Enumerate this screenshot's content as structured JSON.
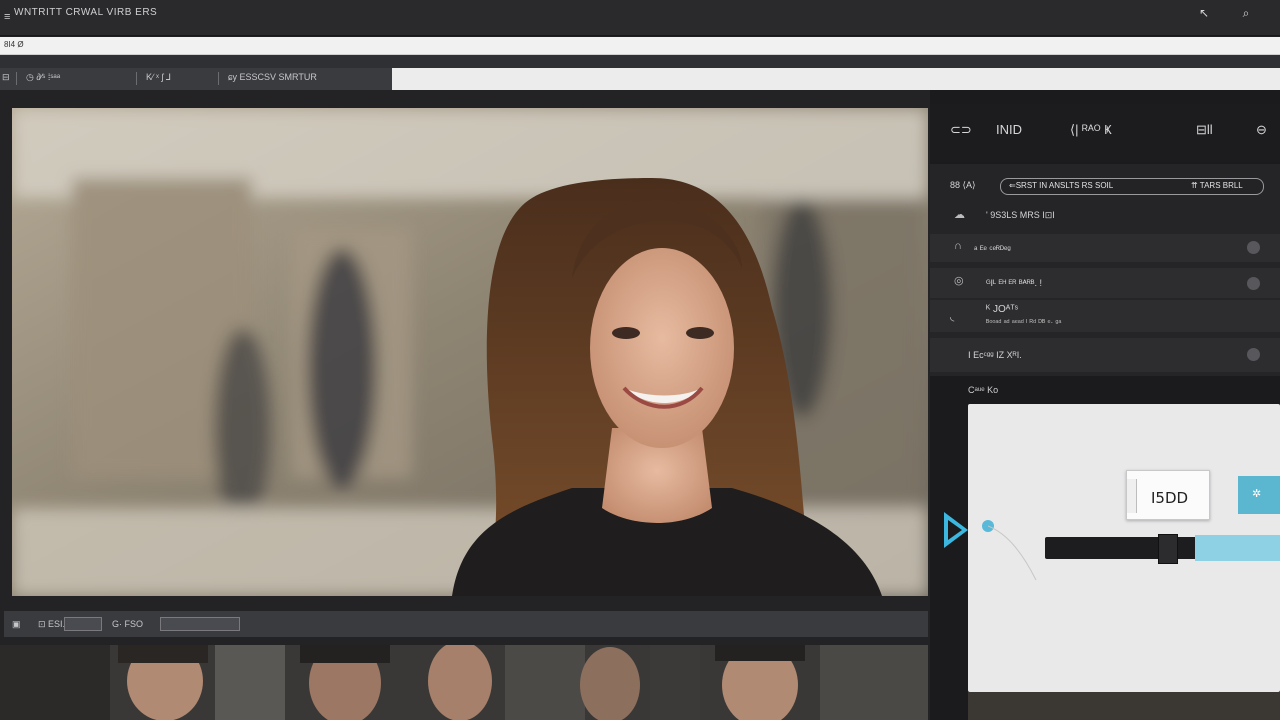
{
  "window": {
    "title": "WNTRITT CRWAL  VIRB ERS",
    "menu_icon": "hamburger-icon",
    "buttons": [
      {
        "icon": "pin-icon",
        "glyph": "↖"
      },
      {
        "icon": "search-icon",
        "glyph": "⌕"
      }
    ]
  },
  "address_bar": {
    "value": "8I4 Ø"
  },
  "toolbar": {
    "items": [
      {
        "icon": "grid-icon",
        "label": "⊟"
      },
      {
        "icon": "clock-icon",
        "label": "◷  ∂⁄ˢ ⁞ˢᵃᵃ"
      },
      {
        "icon": "ruler-icon",
        "label": "K∕ ˣ ʃ ⅃"
      },
      {
        "icon": "eye-icon",
        "label": "ɕy  ESSCSV SMRTUR"
      }
    ]
  },
  "viewer": {
    "controls": [
      {
        "icon": "frame-icon",
        "label": "▣"
      },
      {
        "icon": "crop-icon",
        "label": "⊡  ESI."
      },
      {
        "label": "G· FSO"
      }
    ]
  },
  "right_panel": {
    "tools": [
      {
        "icon": "comment-icon",
        "label": "⊂⊃"
      },
      {
        "icon": "text-tool-icon",
        "label": "INID"
      },
      {
        "icon": "adjust-icon",
        "label": "⟨| ᴿᴬᴼ Ҝ"
      },
      {
        "icon": "histogram-icon",
        "label": "⊟ll"
      },
      {
        "icon": "zoom-icon",
        "label": "⊖"
      }
    ],
    "search": {
      "prefix": "88 ⟨A⟩",
      "value": "⇐SRST  IN ANSLTS RS SOIL",
      "suffix": "⇈ TARS BRLL"
    },
    "rows": [
      {
        "icon": "cloud-icon",
        "label": "' 9S3LS MRS I⊡I",
        "has_toggle": false
      },
      {
        "icon": "headphones-icon",
        "label": "ᵃ ᴱᵉ ᶜᵉᴿᴰᵉᵍ",
        "has_toggle": true
      },
      {
        "icon": "layers-icon",
        "label": "ᴳIᴸ ᴱᴴ ᴱᴿ ᴮᴬᴿᴮ.  !",
        "has_toggle": true
      },
      {
        "icon": "brush-icon",
        "label": "ᴷ JOᴬᵀˢ",
        "sublabel": "ᴮᵒᵒᵃᵈ ᵃᵈ ᵃᵉᵃᵈ  ᴵ ᴿᵈ ᴰᴮ  ᵉ· ᵍᵃ",
        "has_toggle": false
      },
      {
        "icon": "settings-icon",
        "label": "Ⅰ Ecᶜᵍᵍ IZ XᴿI.",
        "has_toggle": true
      }
    ],
    "section_label": "Cᵃᵘᵉ Ko",
    "card": {
      "value_box": "I5DD",
      "button_glyph": "✲",
      "slider_value": 0.6
    }
  },
  "colors": {
    "accent": "#5ab7cf",
    "panel": "#1b1b1d",
    "titlebar": "#2a2a2d"
  }
}
